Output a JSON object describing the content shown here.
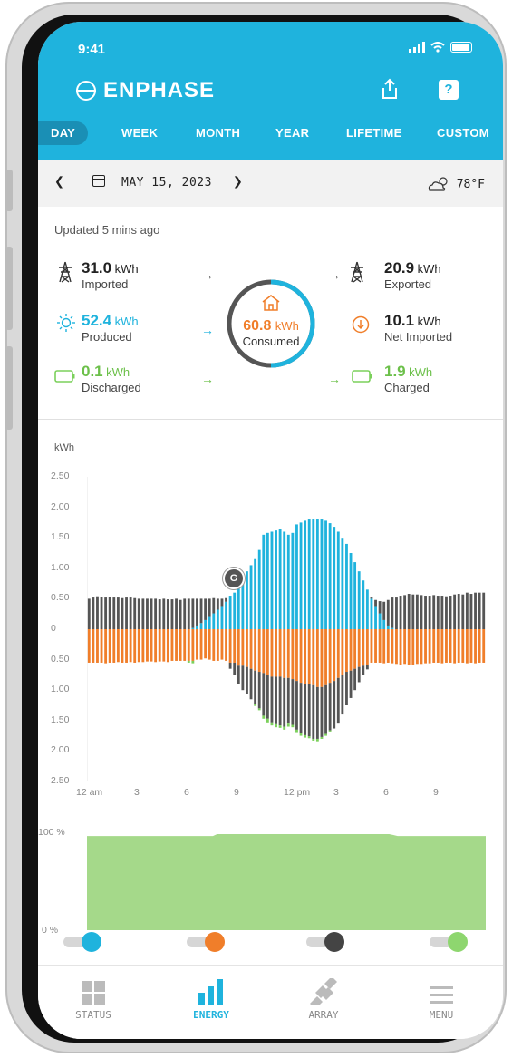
{
  "status_bar": {
    "time": "9:41"
  },
  "header": {
    "brand": "ENPHASE"
  },
  "tabs": [
    {
      "label": "DAY",
      "active": true
    },
    {
      "label": "WEEK"
    },
    {
      "label": "MONTH"
    },
    {
      "label": "YEAR"
    },
    {
      "label": "LIFETIME"
    },
    {
      "label": "CUSTOM"
    }
  ],
  "date_bar": {
    "date": "MAY 15, 2023",
    "weather": "78°F"
  },
  "summary": {
    "updated": "Updated 5 mins ago",
    "imported": {
      "value": "31.0",
      "unit": "kWh",
      "label": "Imported"
    },
    "produced": {
      "value": "52.4",
      "unit": "kWh",
      "label": "Produced"
    },
    "discharged": {
      "value": "0.1",
      "unit": "kWh",
      "label": "Discharged"
    },
    "exported": {
      "value": "20.9",
      "unit": "kWh",
      "label": "Exported"
    },
    "net_imported": {
      "value": "10.1",
      "unit": "kWh",
      "label": "Net Imported"
    },
    "charged": {
      "value": "1.9",
      "unit": "kWh",
      "label": "Charged"
    },
    "consumed": {
      "value": "60.8",
      "unit": "kWh",
      "label": "Consumed"
    }
  },
  "colors": {
    "brand": "#1fb3dd",
    "solar": "#1fb3dd",
    "consumption": "#f07e2a",
    "grid": "#555555",
    "battery": "#7bd05b",
    "battery_fill": "#a5d98a"
  },
  "chart_data": [
    {
      "type": "bar",
      "ylabel": "kWh",
      "y_ticks_top": [
        "2.50",
        "2.00",
        "1.50",
        "1.00",
        "0.50",
        "0"
      ],
      "y_ticks_bottom": [
        "0.50",
        "1.00",
        "1.50",
        "2.00",
        "2.50"
      ],
      "x_ticks": [
        "12 am",
        "3",
        "6",
        "9",
        "12 pm",
        "3",
        "6",
        "9"
      ],
      "ylim": [
        -2.5,
        2.5
      ],
      "intervals": 96,
      "series": [
        {
          "name": "solar",
          "values": [
            0,
            0,
            0,
            0,
            0,
            0,
            0,
            0,
            0,
            0,
            0,
            0,
            0,
            0,
            0,
            0,
            0,
            0,
            0,
            0,
            0,
            0,
            0,
            0,
            0,
            0.02,
            0.06,
            0.1,
            0.15,
            0.2,
            0.26,
            0.32,
            0.38,
            0.45,
            0.55,
            0.6,
            0.7,
            0.8,
            0.95,
            1.05,
            1.15,
            1.3,
            1.55,
            1.58,
            1.6,
            1.62,
            1.65,
            1.6,
            1.55,
            1.58,
            1.72,
            1.75,
            1.78,
            1.8,
            1.8,
            1.8,
            1.8,
            1.78,
            1.74,
            1.68,
            1.6,
            1.5,
            1.4,
            1.25,
            1.1,
            0.95,
            0.8,
            0.65,
            0.5,
            0.38,
            0.26,
            0.15,
            0.06,
            0.02,
            0,
            0,
            0,
            0,
            0,
            0,
            0,
            0,
            0,
            0,
            0,
            0,
            0,
            0,
            0,
            0,
            0,
            0,
            0,
            0,
            0,
            0
          ]
        },
        {
          "name": "grid_import",
          "values": [
            0.5,
            0.52,
            0.54,
            0.53,
            0.52,
            0.53,
            0.52,
            0.52,
            0.51,
            0.52,
            0.52,
            0.51,
            0.5,
            0.5,
            0.5,
            0.5,
            0.5,
            0.49,
            0.5,
            0.49,
            0.49,
            0.5,
            0.48,
            0.5,
            0.5,
            0.48,
            0.44,
            0.4,
            0.35,
            0.3,
            0.25,
            0.18,
            0.12,
            0.06,
            0,
            0,
            0,
            0,
            0,
            0,
            0,
            0,
            0,
            0,
            0,
            0,
            0,
            0,
            0,
            0,
            0,
            0,
            0,
            0,
            0,
            0,
            0,
            0,
            0,
            0,
            0,
            0,
            0,
            0,
            0,
            0,
            0,
            0,
            0.02,
            0.1,
            0.2,
            0.3,
            0.42,
            0.5,
            0.52,
            0.55,
            0.56,
            0.58,
            0.57,
            0.57,
            0.56,
            0.55,
            0.55,
            0.56,
            0.55,
            0.55,
            0.54,
            0.55,
            0.57,
            0.58,
            0.57,
            0.6,
            0.58,
            0.6,
            0.6,
            0.6
          ]
        },
        {
          "name": "consumption",
          "values": [
            0.55,
            0.55,
            0.55,
            0.55,
            0.56,
            0.55,
            0.55,
            0.54,
            0.55,
            0.55,
            0.54,
            0.55,
            0.54,
            0.54,
            0.53,
            0.53,
            0.54,
            0.53,
            0.53,
            0.54,
            0.52,
            0.52,
            0.52,
            0.52,
            0.52,
            0.52,
            0.5,
            0.5,
            0.48,
            0.5,
            0.52,
            0.52,
            0.5,
            0.52,
            0.55,
            0.55,
            0.6,
            0.6,
            0.62,
            0.65,
            0.68,
            0.7,
            0.72,
            0.75,
            0.78,
            0.78,
            0.78,
            0.8,
            0.8,
            0.82,
            0.85,
            0.88,
            0.9,
            0.9,
            0.92,
            0.95,
            0.95,
            0.92,
            0.88,
            0.85,
            0.8,
            0.75,
            0.7,
            0.68,
            0.65,
            0.62,
            0.6,
            0.58,
            0.55,
            0.55,
            0.55,
            0.56,
            0.55,
            0.56,
            0.57,
            0.58,
            0.57,
            0.58,
            0.58,
            0.57,
            0.57,
            0.56,
            0.56,
            0.55,
            0.55,
            0.56,
            0.55,
            0.55,
            0.56,
            0.55,
            0.55,
            0.56,
            0.55,
            0.56,
            0.55,
            0.55
          ]
        },
        {
          "name": "grid_export",
          "values": [
            0,
            0,
            0,
            0,
            0,
            0,
            0,
            0,
            0,
            0,
            0,
            0,
            0,
            0,
            0,
            0,
            0,
            0,
            0,
            0,
            0,
            0,
            0,
            0,
            0,
            0,
            0,
            0,
            0,
            0,
            0,
            0,
            0,
            0,
            0.1,
            0.2,
            0.3,
            0.4,
            0.45,
            0.5,
            0.55,
            0.6,
            0.7,
            0.72,
            0.75,
            0.78,
            0.8,
            0.8,
            0.75,
            0.75,
            0.8,
            0.82,
            0.84,
            0.86,
            0.88,
            0.85,
            0.82,
            0.8,
            0.78,
            0.78,
            0.75,
            0.65,
            0.55,
            0.45,
            0.35,
            0.25,
            0.15,
            0.08,
            0,
            0,
            0,
            0,
            0,
            0,
            0,
            0,
            0,
            0,
            0,
            0,
            0,
            0,
            0,
            0,
            0,
            0,
            0,
            0,
            0,
            0,
            0,
            0,
            0,
            0,
            0,
            0
          ]
        },
        {
          "name": "battery_charge",
          "values": [
            0,
            0,
            0,
            0,
            0,
            0,
            0,
            0,
            0,
            0,
            0,
            0,
            0,
            0,
            0,
            0,
            0,
            0,
            0,
            0,
            0,
            0,
            0,
            0,
            0.03,
            0.04,
            0,
            0,
            0,
            0,
            0,
            0,
            0,
            0,
            0,
            0,
            0,
            0,
            0,
            0,
            0.03,
            0.03,
            0.05,
            0.06,
            0.05,
            0.05,
            0.04,
            0.05,
            0.05,
            0.04,
            0.04,
            0.05,
            0.04,
            0.03,
            0.03,
            0.04,
            0.03,
            0.03,
            0.02,
            0,
            0,
            0,
            0,
            0,
            0,
            0,
            0,
            0,
            0,
            0,
            0,
            0,
            0,
            0,
            0,
            0,
            0,
            0,
            0,
            0,
            0,
            0,
            0,
            0,
            0,
            0,
            0,
            0,
            0,
            0,
            0,
            0,
            0,
            0,
            0,
            0
          ]
        }
      ]
    },
    {
      "type": "area",
      "ylabel": "",
      "y_ticks": [
        "100 %",
        "0 %"
      ],
      "ylim": [
        0,
        100
      ],
      "series": [
        {
          "name": "battery_soc",
          "values": [
            98,
            98,
            98,
            98,
            98,
            98,
            98,
            98,
            98,
            98,
            98,
            98,
            98,
            98,
            98,
            98,
            98,
            98,
            98,
            98,
            98,
            98,
            98,
            98,
            98,
            98,
            98,
            98,
            98,
            98,
            98,
            100,
            100,
            100,
            100,
            100,
            100,
            100,
            100,
            100,
            100,
            100,
            100,
            100,
            100,
            100,
            100,
            100,
            100,
            100,
            100,
            100,
            100,
            100,
            100,
            100,
            100,
            100,
            100,
            100,
            100,
            100,
            100,
            100,
            100,
            100,
            100,
            100,
            100,
            100,
            100,
            100,
            100,
            99,
            98,
            98,
            98,
            98,
            98,
            98,
            98,
            98,
            98,
            98,
            98,
            98,
            98,
            98,
            98,
            98,
            98,
            98,
            98,
            98,
            98,
            98
          ]
        }
      ]
    }
  ],
  "toggles": [
    {
      "name": "solar",
      "color": "#1fb3dd"
    },
    {
      "name": "consumption",
      "color": "#f07e2a"
    },
    {
      "name": "grid",
      "color": "#444444"
    },
    {
      "name": "battery",
      "color": "#8ed66f"
    }
  ],
  "bottom_nav": [
    {
      "label": "STATUS",
      "icon": "grid-icon"
    },
    {
      "label": "ENERGY",
      "icon": "bar-chart-icon",
      "active": true
    },
    {
      "label": "ARRAY",
      "icon": "solar-panel-icon"
    },
    {
      "label": "MENU",
      "icon": "hamburger-icon"
    }
  ]
}
